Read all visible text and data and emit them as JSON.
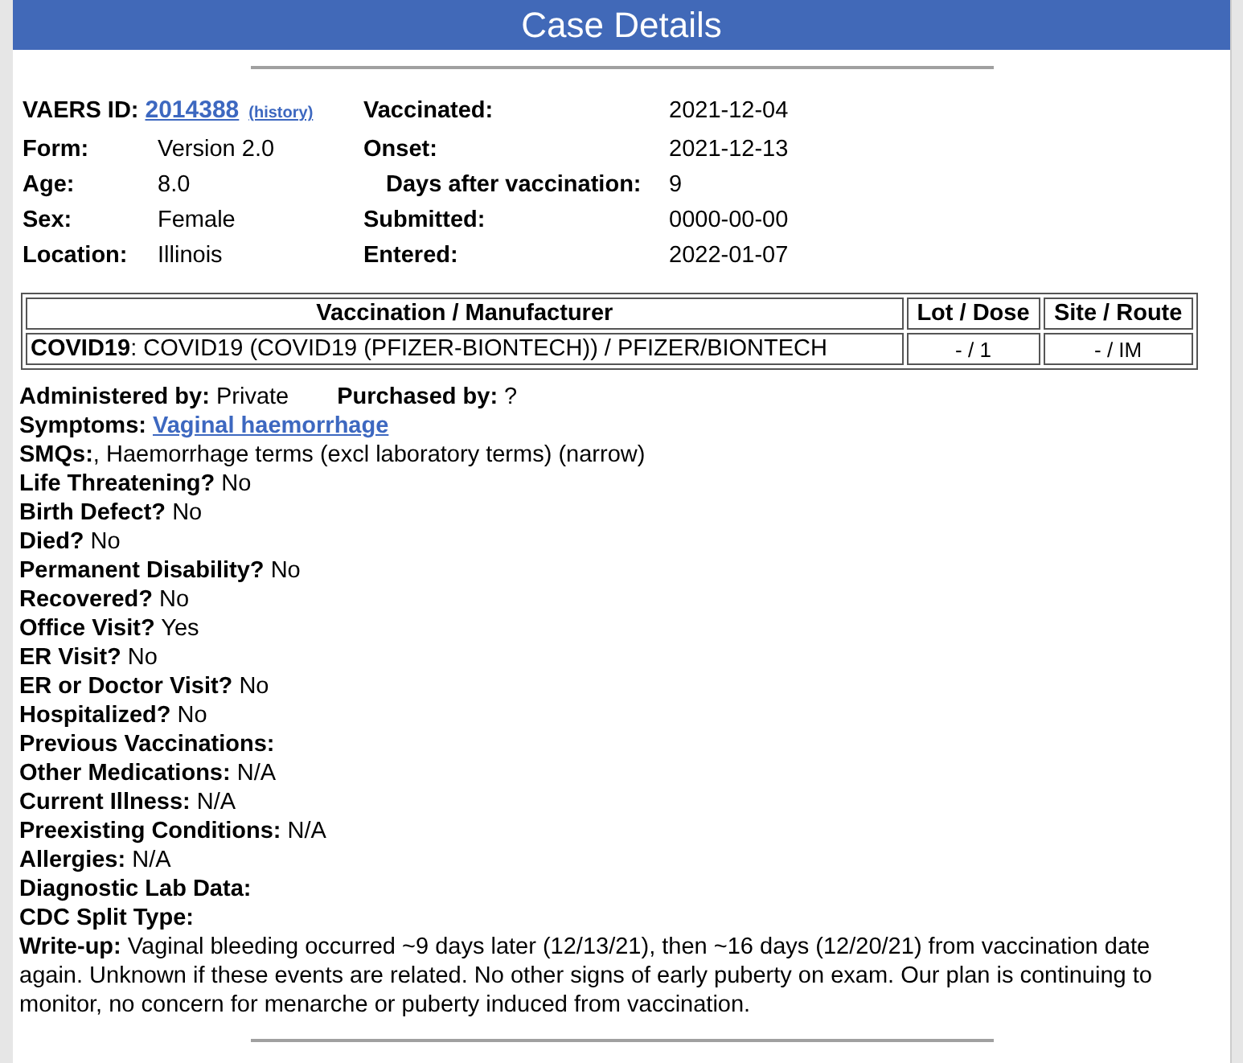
{
  "header": {
    "title": "Case Details"
  },
  "summary": {
    "rows": [
      {
        "left": {
          "kind": "id",
          "label": "VAERS ID:",
          "value": "2014388",
          "history": "(history)"
        },
        "right": {
          "kind": "plain",
          "label": "Vaccinated:",
          "value": "2021-12-04"
        }
      },
      {
        "left": {
          "kind": "plain",
          "label": "Form:",
          "value": "Version 2.0"
        },
        "right": {
          "kind": "plain",
          "label": "Onset:",
          "value": "2021-12-13"
        }
      },
      {
        "left": {
          "kind": "plain",
          "label": "Age:",
          "value": "8.0"
        },
        "right": {
          "kind": "derived",
          "label": "Days after vaccination:",
          "value": "9"
        }
      },
      {
        "left": {
          "kind": "plain",
          "label": "Sex:",
          "value": "Female"
        },
        "right": {
          "kind": "plain",
          "label": "Submitted:",
          "value": "0000-00-00"
        }
      },
      {
        "left": {
          "kind": "plain",
          "label": "Location:",
          "value": "Illinois"
        },
        "right": {
          "kind": "plain",
          "label": "Entered:",
          "value": "2022-01-07"
        }
      }
    ]
  },
  "vaccinations": {
    "columns": [
      "Vaccination / Manufacturer",
      "Lot / Dose",
      "Site / Route"
    ],
    "rows": [
      {
        "vaccine": "COVID19",
        "manufacturer": ": COVID19 (COVID19 (PFIZER-BIONTECH)) / PFIZER/BIONTECH",
        "lot_dose": "- / 1",
        "site_route": "- / IM"
      }
    ]
  },
  "administration": [
    {
      "label": "Administered by:",
      "value": "Private"
    },
    {
      "label": "Purchased by:",
      "value": "?"
    }
  ],
  "details": [
    {
      "kind": "link",
      "label": "Symptoms:",
      "value": "Vaginal haemorrhage"
    },
    {
      "kind": "text",
      "label": "SMQs:",
      "value": ", Haemorrhage terms (excl laboratory terms) (narrow)"
    },
    {
      "kind": "text",
      "label": "Life Threatening?",
      "value": "No"
    },
    {
      "kind": "text",
      "label": "Birth Defect?",
      "value": "No"
    },
    {
      "kind": "text",
      "label": "Died?",
      "value": "No"
    },
    {
      "kind": "text",
      "label": "Permanent Disability?",
      "value": "No"
    },
    {
      "kind": "text",
      "label": "Recovered?",
      "value": "No"
    },
    {
      "kind": "text",
      "label": "Office Visit?",
      "value": "Yes"
    },
    {
      "kind": "text",
      "label": "ER Visit?",
      "value": "No"
    },
    {
      "kind": "text",
      "label": "ER or Doctor Visit?",
      "value": "No"
    },
    {
      "kind": "text",
      "label": "Hospitalized?",
      "value": "No"
    },
    {
      "kind": "text",
      "label": "Previous Vaccinations:"
    },
    {
      "kind": "text",
      "label": "Other Medications:",
      "value": "N/A"
    },
    {
      "kind": "text",
      "label": "Current Illness:",
      "value": "N/A"
    },
    {
      "kind": "text",
      "label": "Preexisting Conditions:",
      "value": "N/A"
    },
    {
      "kind": "text",
      "label": "Allergies:",
      "value": "N/A"
    },
    {
      "kind": "text",
      "label": "Diagnostic Lab Data:"
    },
    {
      "kind": "text",
      "label": "CDC Split Type:"
    },
    {
      "kind": "paragraph",
      "label": "Write-up:",
      "value": "Vaginal bleeding occurred ~9 days later (12/13/21), then ~16 days (12/20/21) from vaccination date again. Unknown if these events are related. No other signs of early puberty on exam. Our plan is continuing to monitor, no concern for menarche or puberty induced from vaccination."
    }
  ]
}
